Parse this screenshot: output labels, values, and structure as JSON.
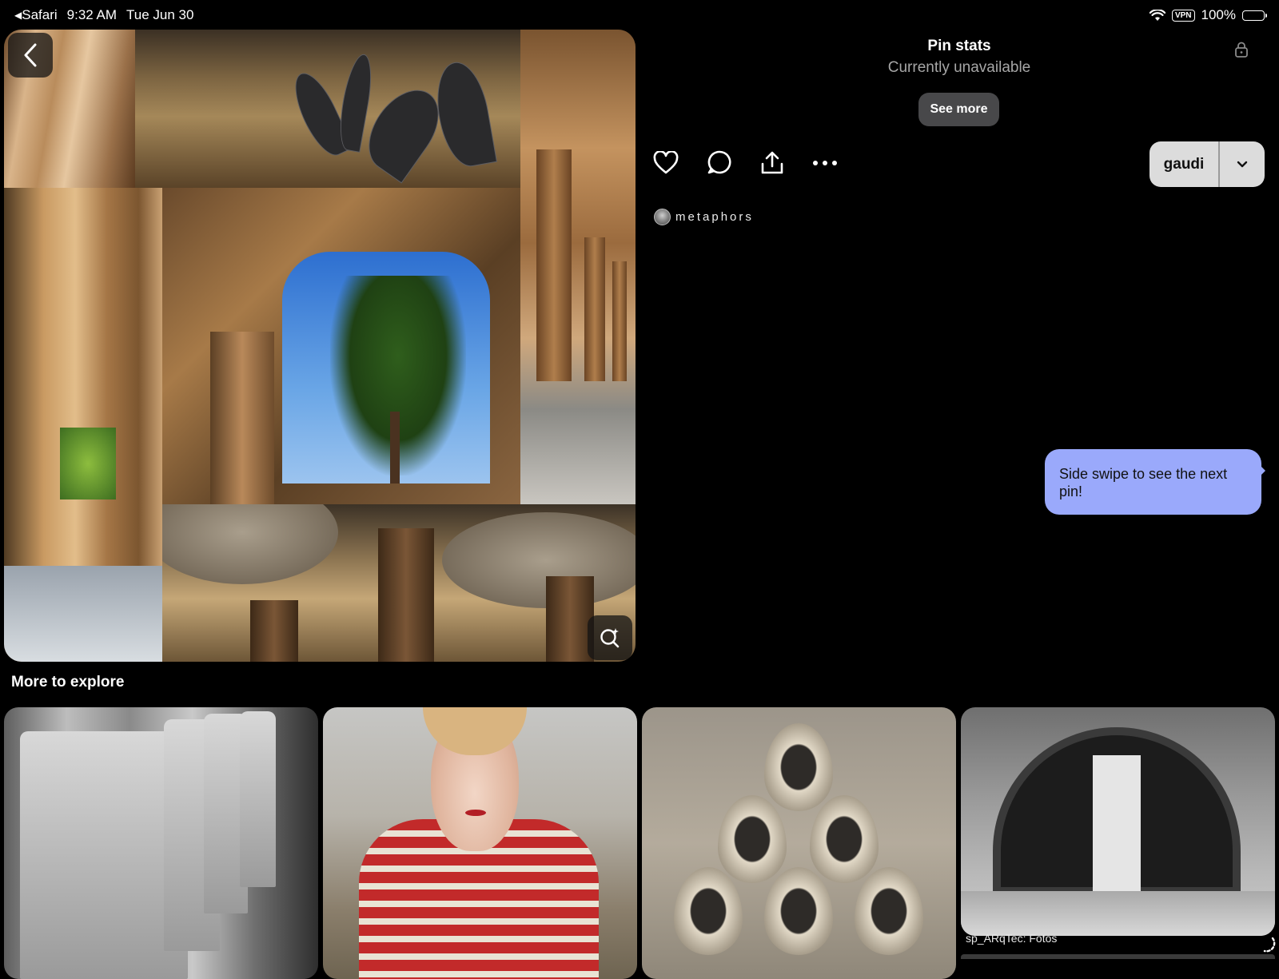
{
  "status_bar": {
    "back_app": "Safari",
    "time": "9:32 AM",
    "date": "Tue Jun 30",
    "vpn": "VPN",
    "battery": "100%"
  },
  "pin_stats": {
    "title": "Pin stats",
    "subtitle": "Currently unavailable",
    "see_more": "See more"
  },
  "board": {
    "name": "gaudi"
  },
  "creator": {
    "name": "metaphors"
  },
  "tooltip": {
    "text": "Side swipe to see the next pin!"
  },
  "explore": {
    "heading": "More to explore",
    "cards": [
      {
        "caption": ""
      },
      {
        "caption": ""
      },
      {
        "caption": ""
      },
      {
        "caption": "sp_ARqTec: Fotos"
      }
    ]
  },
  "icons": {
    "back": "chevron-left-icon",
    "visual_search": "lens-search-icon",
    "lock": "lock-icon",
    "like": "heart-icon",
    "comment": "comment-bubble-icon",
    "share": "share-icon",
    "more": "ellipsis-icon",
    "board_dropdown": "chevron-down-icon"
  },
  "colors": {
    "background": "#000000",
    "tooltip": "#9aa9fb",
    "board_button": "#dcdcdc",
    "see_more_button": "#48484a"
  }
}
